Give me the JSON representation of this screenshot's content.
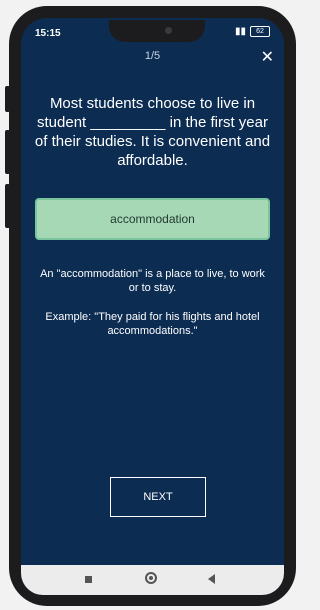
{
  "status_bar": {
    "time": "15:15",
    "battery": "62"
  },
  "header": {
    "progress": "1/5"
  },
  "question": {
    "text": "Most students choose to live in student _________ in the first year of their studies. It is convenient and affordable."
  },
  "answer": {
    "text": "accommodation"
  },
  "explanation": {
    "definition": "An \"accommodation\" is a place to live, to work or to stay.",
    "example": "Example: \"They paid for his flights and hotel accommodations.\""
  },
  "actions": {
    "next_label": "NEXT"
  },
  "colors": {
    "background": "#0c2c52",
    "answer_fill": "#a6d8b5",
    "answer_border": "#79c49c"
  },
  "icons": {
    "close": "close-icon",
    "nav_recent": "square-icon",
    "nav_home": "circle-icon",
    "nav_back": "triangle-back-icon"
  }
}
